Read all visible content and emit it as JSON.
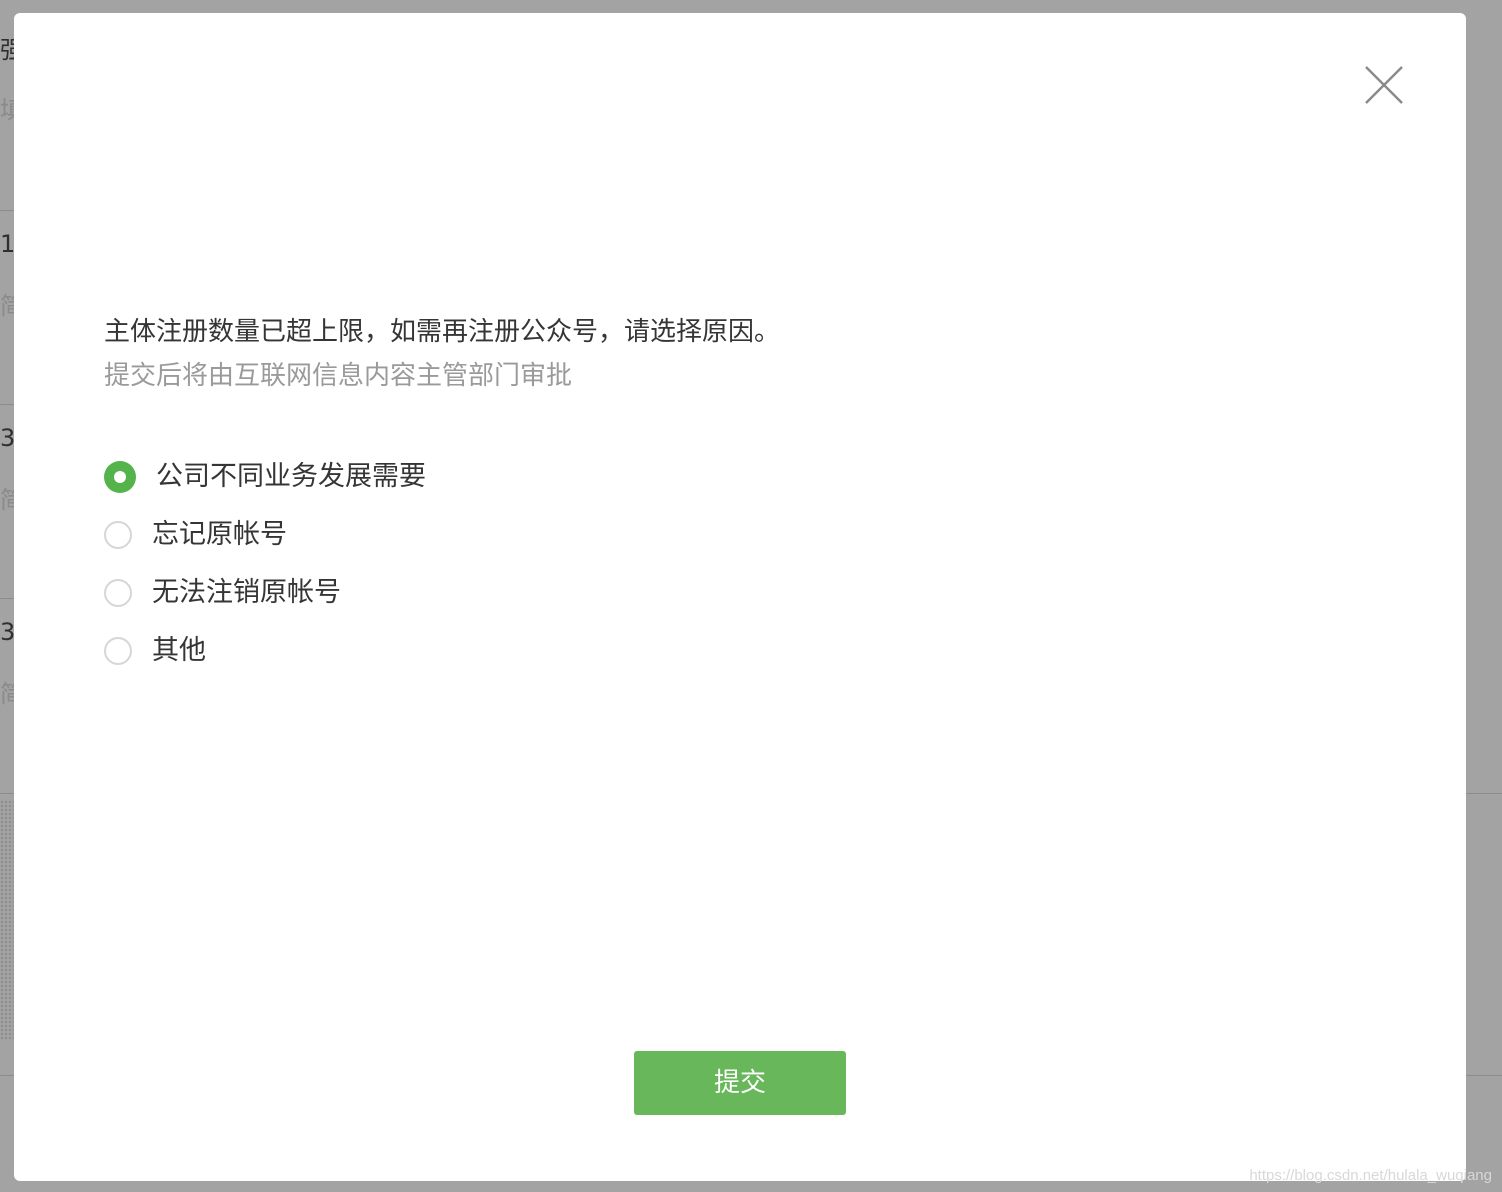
{
  "background": {
    "fragments": [
      "强",
      "填",
      "1",
      "简",
      "3",
      "简",
      "3",
      "简"
    ]
  },
  "dialog": {
    "close_icon": "close-icon",
    "prompt_title": "主体注册数量已超上限，如需再注册公众号，请选择原因。",
    "prompt_subtitle": "提交后将由互联网信息内容主管部门审批",
    "options": [
      {
        "label": "公司不同业务发展需要",
        "selected": true
      },
      {
        "label": "忘记原帐号",
        "selected": false
      },
      {
        "label": "无法注销原帐号",
        "selected": false
      },
      {
        "label": "其他",
        "selected": false
      }
    ],
    "submit_label": "提交"
  },
  "watermark": "https://blog.csdn.net/hulala_wuqiang",
  "colors": {
    "accent": "#54b34a",
    "button": "#68b75b",
    "overlay": "#9b9b9b"
  }
}
